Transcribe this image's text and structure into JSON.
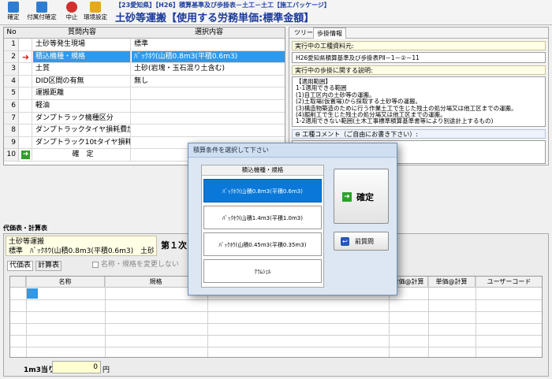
{
  "toolbar": {
    "buttons": [
      {
        "label": "確定",
        "color": "#2e7dd1"
      },
      {
        "label": "付属付確定",
        "color": "#2e7dd1"
      },
      {
        "label": "中止",
        "color": "#d23030"
      },
      {
        "label": "環境設定",
        "color": "#e6a91e"
      }
    ],
    "subtitle": "【23愛知県】【H26】積算基準及び歩掛表－土工－土工【施工パッケージ】",
    "title": "土砂等運搬【使用する労務単価:標準金額】"
  },
  "questions": {
    "headers": {
      "no": "No",
      "q": "質問内容",
      "a": "選択内容"
    },
    "rows": [
      {
        "no": "1",
        "q": "土砂等発生現場",
        "a": "標準"
      },
      {
        "no": "2",
        "q": "積込機種・規格",
        "a": "ﾊﾞｯｸﾎｳ(山積0.8m3(平積0.6m3)"
      },
      {
        "no": "3",
        "q": "土質",
        "a": "土砂(岩塊・玉石混り土含む)"
      },
      {
        "no": "4",
        "q": "DID区間の有無",
        "a": "無し"
      },
      {
        "no": "5",
        "q": "運搬距離",
        "a": ""
      },
      {
        "no": "6",
        "q": "軽油",
        "a": ""
      },
      {
        "no": "7",
        "q": "ダンプトラック機種区分",
        "a": ""
      },
      {
        "no": "8",
        "q": "ダンプトラックタイヤ損耗費加算区分",
        "a": ""
      },
      {
        "no": "9",
        "q": "ダンプトラック10tタイヤ損耗費",
        "a": ""
      },
      {
        "no": "10",
        "q": "確　定",
        "a": ""
      }
    ]
  },
  "right_panel": {
    "tabs": [
      "ツリー",
      "歩掛情報"
    ],
    "current_data_label": "実行中の工種資料元:",
    "current_data_value": "H26愛知県積算基準及び歩掛表PⅡ－1－②－11",
    "desc_label": "実行中の歩掛に関する説明:",
    "desc_lines": [
      "【適用範囲】",
      "1-1適用できる範囲",
      "(1)自工区内の土砂等の運搬。",
      "(2)土取場(仮置場)から採取する土砂等の運搬。",
      "(3)構造物築造のために行う作業土工で生じた残土の処分場又は他工区までの運搬。",
      "(4)掘削工で生じた残土の処分場又は他工区までの運搬。",
      "1-2適用できない範囲(土木工事標準積算基準書等により別途計上するもの)"
    ],
    "comment_label": "工種コメント（ご自由にお書き下さい）:"
  },
  "bottom": {
    "section_title": "代価表・計算表",
    "item_name": "土砂等運搬",
    "item_spec": "標準　ﾊﾞｯｸﾎｳ(山積0.8m3(平積0.6m3)　土砂(岩塊",
    "tab_first": "第１次",
    "subtabs": [
      "代価表",
      "計算表"
    ],
    "checkbox_label": "名称・規格を変更しない",
    "columns": [
      "名称",
      "規格",
      "単価@計算",
      "単価@計算",
      "ユーザーコード"
    ],
    "per_unit_label": "1m3当り",
    "per_unit_value": "0",
    "currency": "円"
  },
  "dialog": {
    "title": "積算条件を選択して下さい",
    "options_header": "積込機種・規格",
    "options": [
      "ﾊﾞｯｸﾎｳ(山積0.8m3(平積0.6m3)",
      "ﾊﾞｯｸﾎｳ(山積1.4m3(平積1.0m3)",
      "ﾊﾞｯｸﾎｳ(山積0.45m3(平積0.35m3)",
      "ｸﾗﾑｼｪﾙ"
    ],
    "confirm_label": "確定",
    "prev_label": "前質問"
  },
  "colors": {
    "selection": "#3399e6",
    "dialog_selection": "#0a78d8",
    "title_blue": "#1a3a9a"
  }
}
